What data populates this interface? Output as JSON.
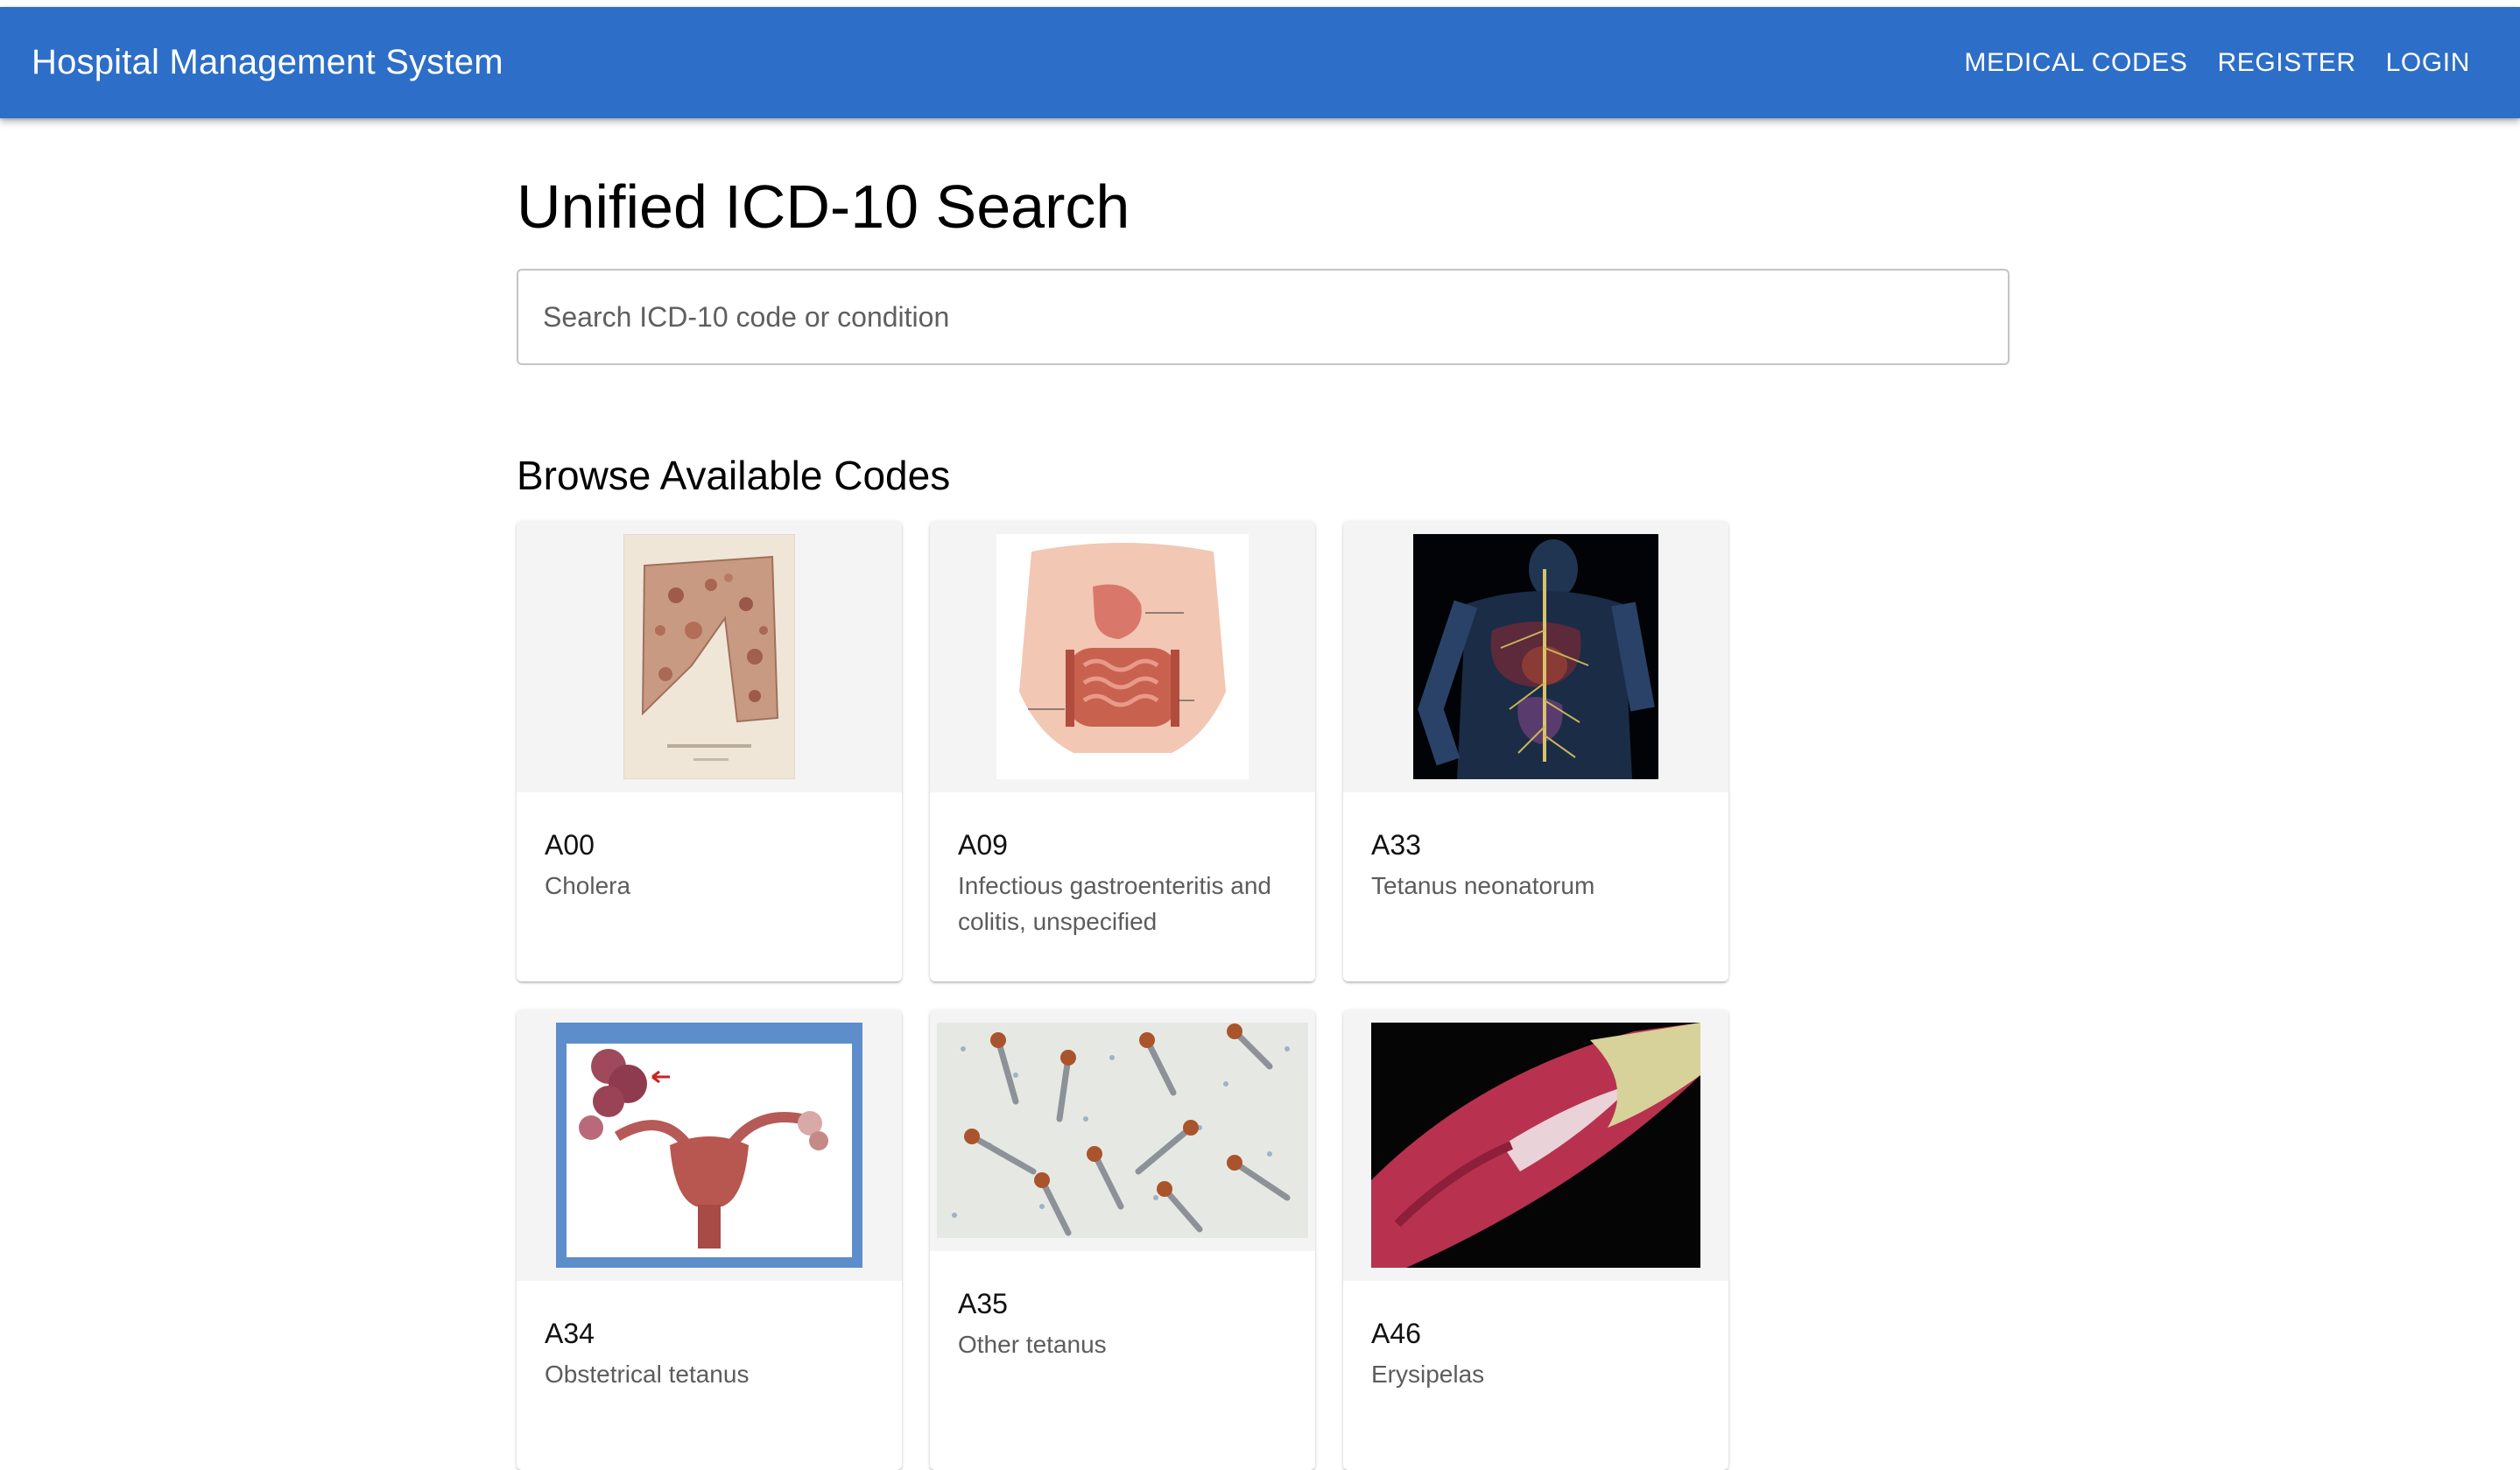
{
  "app": {
    "title": "Hospital Management System"
  },
  "nav": {
    "items": [
      "MEDICAL CODES",
      "REGISTER",
      "LOGIN"
    ]
  },
  "page": {
    "title": "Unified ICD-10 Search",
    "search_placeholder": "Search ICD-10 code or condition",
    "search_value": "",
    "browse_heading": "Browse Available Codes"
  },
  "codes": [
    {
      "code": "A00",
      "description": "Cholera",
      "image": "cholera-skin-plate"
    },
    {
      "code": "A09",
      "description": "Infectious gastroenteritis and colitis, unspecified",
      "image": "digestive-anatomy",
      "image_labels": [
        "Stomach",
        "Large intestine",
        "Small intestine"
      ]
    },
    {
      "code": "A33",
      "description": "Tetanus neonatorum",
      "image": "nervous-system-xray"
    },
    {
      "code": "A34",
      "description": "Obstetrical tetanus",
      "image": "hydrosalpinx-diagram",
      "image_labels": [
        "Hydrosalpinx"
      ]
    },
    {
      "code": "A35",
      "description": "Other tetanus",
      "image": "bacteria-micrograph"
    },
    {
      "code": "A46",
      "description": "Erysipelas",
      "image": "erysipelas-skin"
    }
  ],
  "colors": {
    "appbar": "#2d6ec8",
    "text_secondary": "#5c5c5c"
  }
}
